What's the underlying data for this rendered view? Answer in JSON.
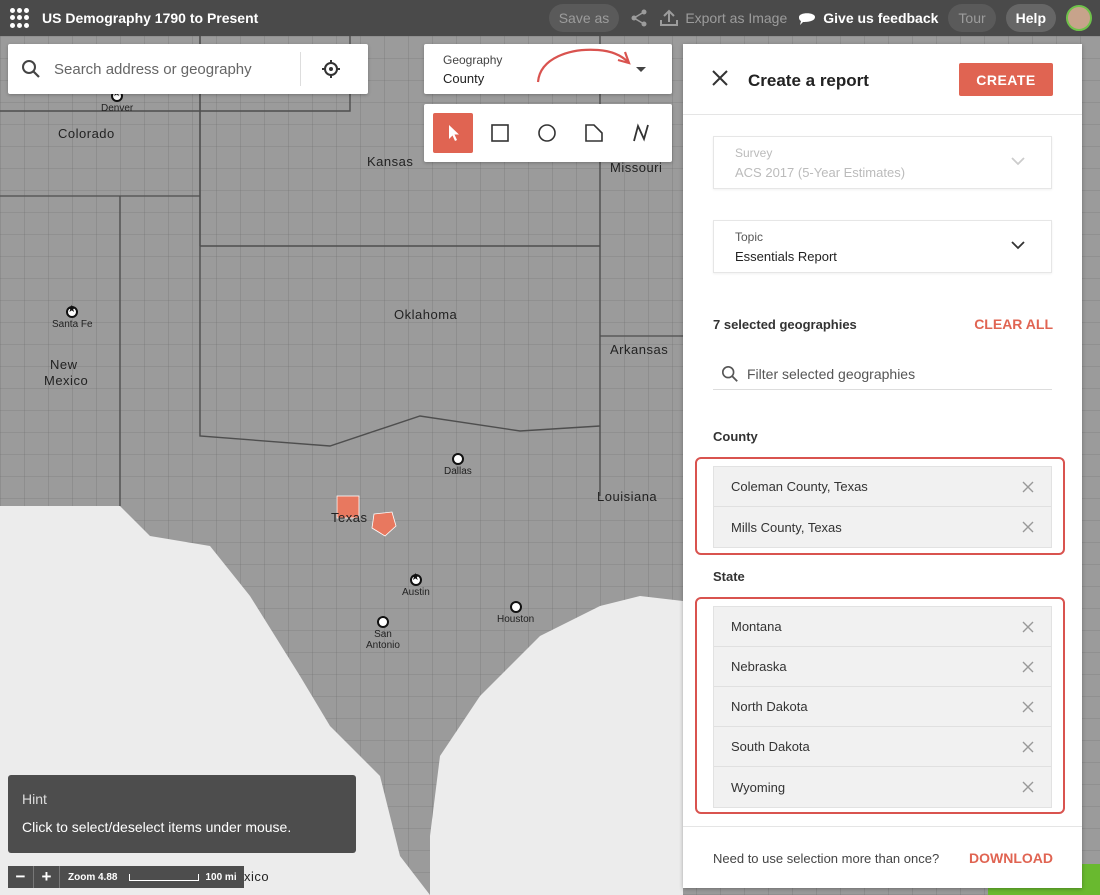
{
  "topbar": {
    "app_title": "US Demography 1790 to Present",
    "save_as": "Save as",
    "export": "Export as Image",
    "feedback": "Give us feedback",
    "tour": "Tour",
    "help": "Help"
  },
  "search": {
    "placeholder": "Search address or geography"
  },
  "geography": {
    "label": "Geography",
    "value": "County"
  },
  "tools": [
    "pointer-select",
    "rectangle-select",
    "circle-select",
    "polygon-select",
    "line-select"
  ],
  "map": {
    "labels": {
      "colorado": "Colorado",
      "kansas": "Kansas",
      "missouri": "Missouri",
      "oklahoma": "Oklahoma",
      "arkansas": "Arkansas",
      "new_mexico_1": "New",
      "new_mexico_2": "Mexico",
      "texas": "Texas",
      "louisiana": "Louisiana"
    },
    "cities": {
      "denver": "Denver",
      "santa_fe": "Santa Fe",
      "dallas": "Dallas",
      "austin": "Austin",
      "san_antonio_1": "San",
      "san_antonio_2": "Antonio",
      "houston": "Houston"
    },
    "highlight_color": "#e8785f"
  },
  "panel": {
    "title": "Create a report",
    "create": "CREATE",
    "survey": {
      "label": "Survey",
      "value": "ACS 2017 (5-Year Estimates)"
    },
    "topic": {
      "label": "Topic",
      "value": "Essentials Report"
    },
    "selected_count": "7 selected geographies",
    "clear_all": "CLEAR ALL",
    "filter_placeholder": "Filter selected geographies",
    "county_title": "County",
    "counties": [
      "Coleman County, Texas",
      "Mills County, Texas"
    ],
    "state_title": "State",
    "states": [
      "Montana",
      "Nebraska",
      "North Dakota",
      "South Dakota",
      "Wyoming"
    ],
    "footer_text": "Need to use selection more than once?",
    "download": "DOWNLOAD"
  },
  "hint": {
    "title": "Hint",
    "text": "Click to select/deselect items under mouse."
  },
  "zoom": {
    "level": "Zoom 4.88",
    "scale": "100 mi"
  },
  "map_edge_text": "xico",
  "accent_color": "#e06452",
  "annotation_color": "#d9534f"
}
